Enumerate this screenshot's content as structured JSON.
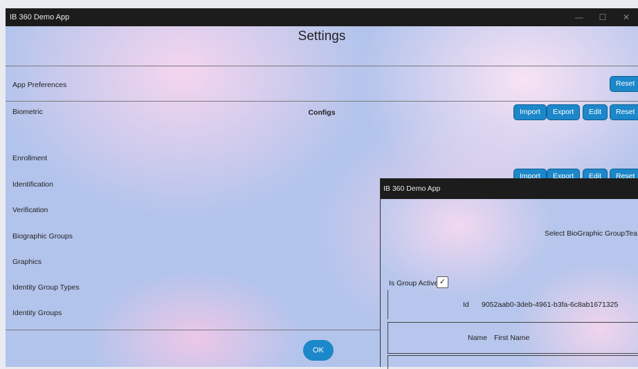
{
  "window": {
    "title": "IB 360 Demo App",
    "controls": [
      "—",
      "☐",
      "✕"
    ]
  },
  "page_title": "Settings",
  "app_preferences": {
    "label": "App Preferences",
    "reset_label": "Reset"
  },
  "configs": {
    "heading": "Configs",
    "button_labels": {
      "import": "Import",
      "export": "Export",
      "edit": "Edit",
      "reset": "Reset"
    },
    "rows": [
      "Biometric",
      "Enrollment",
      "Identification",
      "Verification",
      "Biographic Groups",
      "Graphics",
      "Identity Group Types",
      "Identity Groups"
    ]
  },
  "ok_label": "OK",
  "popup": {
    "title": "IB 360 Demo App",
    "select_group_label": "Select BioGraphic Group:",
    "select_group_value": "Tea",
    "is_group_active_label": "Is Group Active",
    "is_group_active_checked": true,
    "checkmark": "✓",
    "id_label": "Id",
    "id_value": "9052aab0-3deb-4961-b3fa-6c8ab1671325",
    "name_label": "Name",
    "name_value": "First Name"
  }
}
